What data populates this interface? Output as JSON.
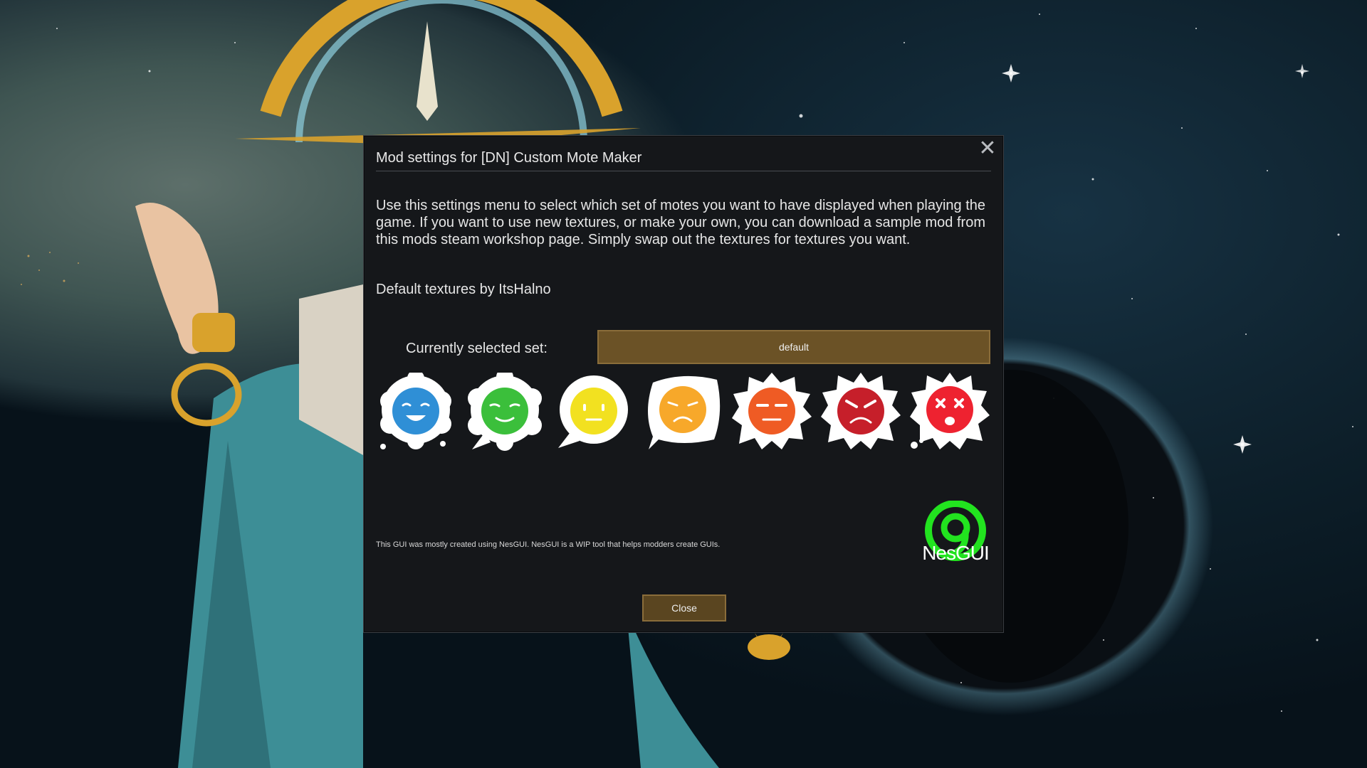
{
  "dialog": {
    "title": "Mod settings for [DN] Custom Mote Maker",
    "close_icon": "close-icon",
    "description": "Use this settings menu to select which set of motes you want to have displayed when playing the game. If you want to use new textures, or make your own, you can download a sample mod from this mods steam workshop page. Simply swap out the textures for textures you want.",
    "credit": "Default textures by ItsHalno",
    "set_label": "Currently selected set:",
    "set_value": "default",
    "motes": [
      {
        "name": "mote-happy-blue",
        "color": "#2f8fd6"
      },
      {
        "name": "mote-content-green",
        "color": "#3bbf3b"
      },
      {
        "name": "mote-neutral-yellow",
        "color": "#f2e120"
      },
      {
        "name": "mote-sad-orange",
        "color": "#f7a82a"
      },
      {
        "name": "mote-annoyed-orange",
        "color": "#ef5b24"
      },
      {
        "name": "mote-angry-red",
        "color": "#c61f2a"
      },
      {
        "name": "mote-dead-red",
        "color": "#ee2230"
      }
    ],
    "footer_note": "This GUI was mostly created using NesGUI. NesGUI is a WIP tool that helps modders create GUIs.",
    "logo_text": "NesGUI",
    "logo_color": "#22e31f",
    "close_label": "Close"
  },
  "colors": {
    "dialog_bg": "#15171a",
    "button_brown": "#6b5226",
    "button_border": "#8a6d3a"
  }
}
